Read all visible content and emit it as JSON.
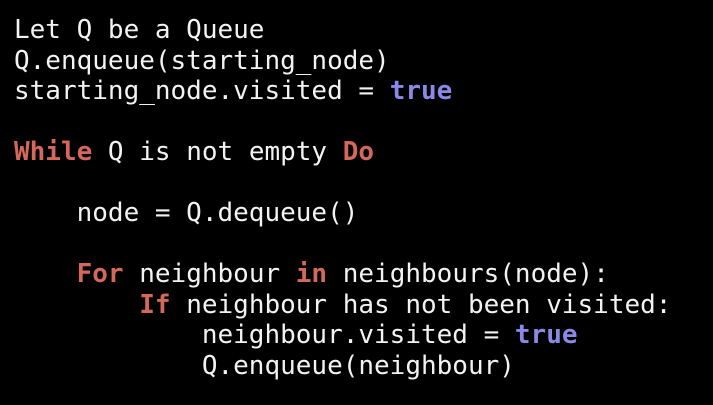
{
  "colors": {
    "background": "#000000",
    "text": "#f2f2f2",
    "keyword": "#d4685a",
    "literal": "#8a8ae6"
  },
  "lines": [
    [
      {
        "text": "Let Q be a Queue",
        "type": "plain"
      }
    ],
    [
      {
        "text": "Q.enqueue(starting_node)",
        "type": "plain"
      }
    ],
    [
      {
        "text": "starting_node.visited = ",
        "type": "plain"
      },
      {
        "text": "true",
        "type": "bool"
      }
    ],
    [],
    [
      {
        "text": "While",
        "type": "kw"
      },
      {
        "text": " Q is not empty ",
        "type": "plain"
      },
      {
        "text": "Do",
        "type": "kw"
      }
    ],
    [],
    [
      {
        "text": "    node = Q.dequeue()",
        "type": "plain"
      }
    ],
    [],
    [
      {
        "text": "    ",
        "type": "plain"
      },
      {
        "text": "For",
        "type": "kw"
      },
      {
        "text": " neighbour ",
        "type": "plain"
      },
      {
        "text": "in",
        "type": "kw"
      },
      {
        "text": " neighbours(node):",
        "type": "plain"
      }
    ],
    [
      {
        "text": "        ",
        "type": "plain"
      },
      {
        "text": "If",
        "type": "kw"
      },
      {
        "text": " neighbour has not been visited:",
        "type": "plain"
      }
    ],
    [
      {
        "text": "            neighbour.visited = ",
        "type": "plain"
      },
      {
        "text": "true",
        "type": "bool"
      }
    ],
    [
      {
        "text": "            Q.enqueue(neighbour)",
        "type": "plain"
      }
    ]
  ]
}
